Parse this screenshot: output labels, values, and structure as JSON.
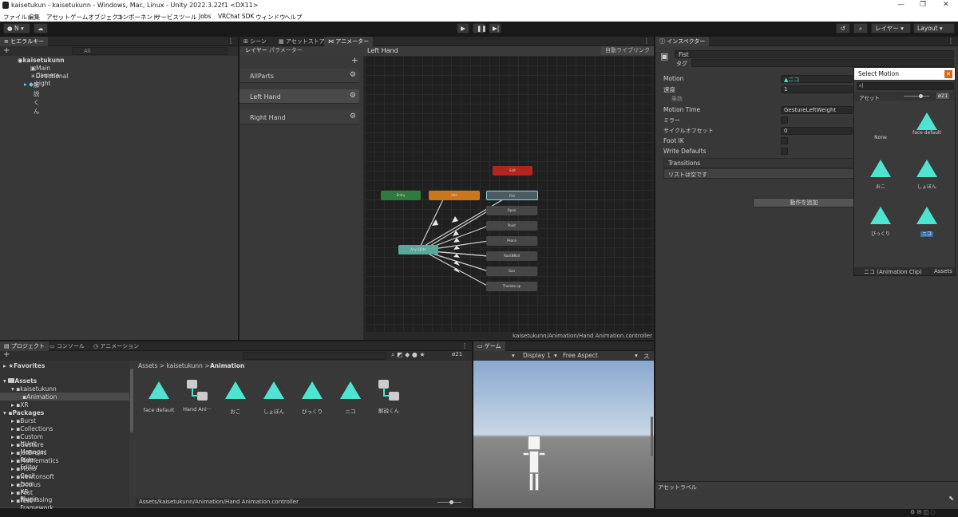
{
  "window": {
    "title": "kaisetukun - kaisetukunn - Windows, Mac, Linux - Unity 2022.3.22f1 <DX11>",
    "minimize": "—",
    "maximize": "❐",
    "close": "✕"
  },
  "menu": [
    "ファイル",
    "編集",
    "アセット",
    "ゲームオブジェクト",
    "コンポーネント",
    "サービス",
    "ツール",
    "Jobs",
    "VRChat SDK",
    "ウィンドウ",
    "ヘルプ"
  ],
  "toolbar": {
    "account": "N",
    "layers": "レイヤー",
    "layout": "Layout"
  },
  "hierarchy": {
    "tab": "ヒエラルキー",
    "search_placeholder": "All",
    "root": "kaisetukunn",
    "items": [
      "Main Camera",
      "Directional Light",
      "解説くん"
    ]
  },
  "animator": {
    "tabs": [
      "シーン",
      "アセットストア",
      "アニメーター"
    ],
    "subtabs": [
      "レイヤー",
      "パラメーター"
    ],
    "breadcrumb": "Left Hand",
    "autolive": "自動ライブリンク",
    "layers": [
      "AllParts",
      "Left Hand",
      "Right Hand"
    ],
    "path": "kaisetukunn/Animation/Hand Animation.controller",
    "nodes": {
      "exit": "Exit",
      "entry": "Entry",
      "idle": "Idle",
      "any": "Any State",
      "fist": "Fist",
      "open": "Open",
      "point": "Point",
      "peace": "Peace",
      "rnr": "RockNRoll",
      "gun": "Gun",
      "thumbs": "Thumbs up"
    }
  },
  "inspector": {
    "tab": "インスペクター",
    "name": "Fist",
    "tag": "タグ",
    "rows": [
      {
        "label": "Motion",
        "value": "▲ニコ"
      },
      {
        "label": "速度",
        "value": "1"
      },
      {
        "label": "乗数",
        "value": ""
      },
      {
        "label": "Motion Time",
        "value": "GestureLeftWeight"
      },
      {
        "label": "ミラー",
        "value": ""
      },
      {
        "label": "サイクルオフセット",
        "value": "0"
      },
      {
        "label": "Foot IK",
        "value": ""
      },
      {
        "label": "Write Defaults",
        "value": ""
      }
    ],
    "transitions": "Transitions",
    "empty_list": "リストは空です",
    "add_behaviour": "動作を追加",
    "asset_label": "アセットラベル"
  },
  "select_motion": {
    "title": "Select Motion",
    "tab": "アセット",
    "count": "21",
    "items": [
      "None",
      "face default",
      "おこ",
      "しょぼん",
      "びっくり",
      "ニコ"
    ],
    "footer": "ニコ (Animation Clip)",
    "footer_right": "Assets"
  },
  "project": {
    "tabs": [
      "プロジェクト",
      "コンソール",
      "アニメーション"
    ],
    "favorites": "Favorites",
    "assets": "Assets",
    "tree": [
      "kaisetukunn",
      "Animation",
      "XR"
    ],
    "packages": "Packages",
    "package_list": [
      "Burst",
      "Collections",
      "Custom NUnit",
      "Gesture Manager",
      "JetBrains Rider Editor",
      "Mathematics",
      "Mono Cecil",
      "Newtonsoft Json",
      "Oculus XR Plugin",
      "Post Processing",
      "Test Framework",
      "TextMeshPro"
    ],
    "breadcrumb_parent": "Assets > kaisetukunn >",
    "breadcrumb_current": "Animation",
    "files": [
      "face default",
      "Hand Ani···",
      "おこ",
      "しょぼん",
      "びっくり",
      "ニコ",
      "解説くん"
    ],
    "status": "Assets/kaisetukunn/Animation/Hand Animation.controller",
    "count": "21"
  },
  "game": {
    "tab": "ゲーム",
    "tab2": "スケ",
    "display": "Display 1",
    "aspect": "Free Aspect"
  },
  "colors": {
    "accent": "#4fe3d2",
    "entry": "#2f7a3f",
    "idle": "#c9771c",
    "exit": "#b3261e",
    "any": "#5aa89a"
  }
}
